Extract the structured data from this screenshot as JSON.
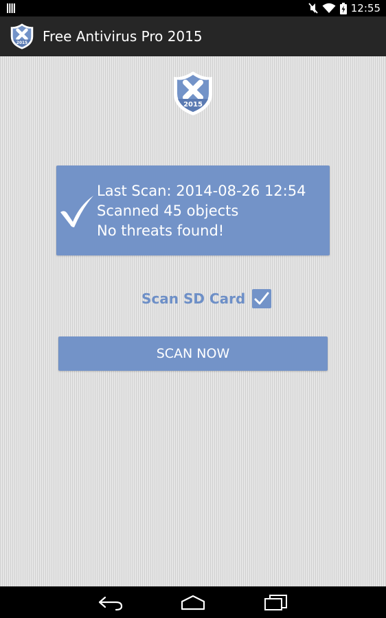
{
  "status_bar": {
    "time": "12:55",
    "icons": [
      "notification-bars-icon",
      "mute-icon",
      "wifi-icon",
      "battery-charging-icon"
    ]
  },
  "action_bar": {
    "icon": "shield-2015-icon",
    "title": "Free Antivirus Pro 2015"
  },
  "logo": {
    "icon": "shield-2015-icon",
    "year": "2015"
  },
  "scan_status": {
    "icon": "checkmark-icon",
    "last_scan": "Last Scan: 2014-08-26 12:54",
    "scanned": "Scanned 45 objects",
    "result": "No threats found!"
  },
  "sd_card": {
    "label": "Scan SD Card",
    "checked": true
  },
  "scan_button": {
    "label": "SCAN NOW"
  },
  "nav_bar": {
    "icons": [
      "back-icon",
      "home-icon",
      "recent-apps-icon"
    ]
  },
  "colors": {
    "accent": "#7393c8",
    "action_bar": "#262626",
    "label_text": "#6d8fc7"
  }
}
